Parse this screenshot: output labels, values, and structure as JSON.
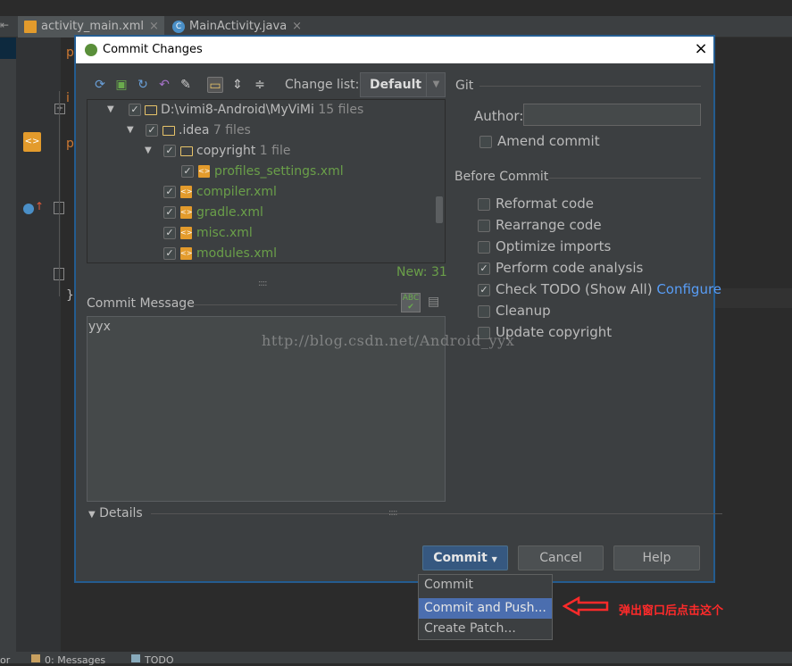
{
  "ide": {
    "tabs": [
      {
        "label": "activity_main.xml",
        "close": "×"
      },
      {
        "label": "MainActivity.java",
        "close": "×"
      }
    ],
    "code_letters": [
      "p",
      "i",
      "p",
      "}"
    ],
    "statusbar": {
      "left": "or",
      "messages": "0: Messages",
      "todo": "TODO"
    }
  },
  "dialog": {
    "title": "Commit Changes",
    "close": "×",
    "toolbar": {
      "icons": [
        "refresh-icon",
        "show-diff-icon",
        "move-icon",
        "revert-icon",
        "edit-source-icon",
        "group-by-directory-icon",
        "expand-all-icon",
        "collapse-all-icon"
      ],
      "changelist_label": "Change list:",
      "changelist_value": "Default"
    },
    "tree": {
      "rows": [
        {
          "name": "D:\\vimi8-Android\\MyViMi",
          "meta": "15 files"
        },
        {
          "name": ".idea",
          "meta": "7 files"
        },
        {
          "name": "copyright",
          "meta": "1 file"
        },
        {
          "name": "profiles_settings.xml",
          "meta": ""
        },
        {
          "name": "compiler.xml",
          "meta": ""
        },
        {
          "name": "gradle.xml",
          "meta": ""
        },
        {
          "name": "misc.xml",
          "meta": ""
        },
        {
          "name": "modules.xml",
          "meta": ""
        }
      ],
      "new_count": "New: 31"
    },
    "commit_message_label": "Commit Message",
    "commit_message": "yyx",
    "spellcheck_icon_text": "ABC",
    "details_label": "Details",
    "git": {
      "section": "Git",
      "author_label": "Author:",
      "author_value": "",
      "amend_label": "Amend commit",
      "amend_checked": false
    },
    "before_commit": {
      "section": "Before Commit",
      "options": [
        {
          "label": "Reformat code",
          "checked": false
        },
        {
          "label": "Rearrange code",
          "checked": false
        },
        {
          "label": "Optimize imports",
          "checked": false
        },
        {
          "label": "Perform code analysis",
          "checked": true
        },
        {
          "label": "Check TODO (Show All)",
          "checked": true,
          "link": "Configure"
        },
        {
          "label": "Cleanup",
          "checked": false
        },
        {
          "label": "Update copyright",
          "checked": false
        }
      ]
    },
    "buttons": {
      "commit": "Commit",
      "cancel": "Cancel",
      "help": "Help"
    }
  },
  "dropdown": {
    "items": [
      {
        "label": "Commit",
        "highlighted": false
      },
      {
        "label": "Commit and Push...",
        "highlighted": true
      },
      {
        "label": "Create Patch...",
        "highlighted": false
      }
    ]
  },
  "annotation": {
    "text": "弹出窗口后点击这个",
    "color": "#ff2a2a"
  },
  "watermark": "http://blog.csdn.net/Android_yyx",
  "colors": {
    "accent": "#365880",
    "highlight": "#4b6eaf",
    "link": "#589df6",
    "green_file": "#6a9f49"
  }
}
